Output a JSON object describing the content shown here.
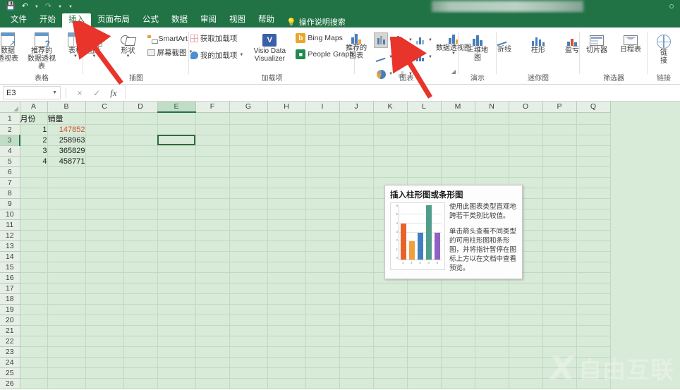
{
  "titlebar": {
    "quick_access": [
      "save-icon",
      "undo-icon",
      "redo-icon",
      "customize-icon"
    ],
    "title_redacted": ""
  },
  "tabs": [
    {
      "label": "文件",
      "active": false
    },
    {
      "label": "开始",
      "active": false
    },
    {
      "label": "插入",
      "active": true
    },
    {
      "label": "页面布局",
      "active": false
    },
    {
      "label": "数据",
      "active": false
    },
    {
      "label": "公式",
      "active": false
    },
    {
      "label": "审阅",
      "active": false
    },
    {
      "label": "视图",
      "active": false
    },
    {
      "label": "帮助",
      "active": false
    }
  ],
  "tabs_ordered": [
    "文件",
    "开始",
    "插入",
    "页面布局",
    "公式",
    "数据",
    "审阅",
    "视图",
    "帮助"
  ],
  "tell_me": "操作说明搜索",
  "ribbon": {
    "groups": [
      {
        "name": "表格",
        "buttons": [
          {
            "label1": "数据",
            "label2": "透视表"
          },
          {
            "label1": "推荐的",
            "label2": "数据透视表"
          },
          {
            "label1": "表格",
            "label2": ""
          }
        ]
      },
      {
        "name": "插图",
        "buttons": [
          {
            "label1": "图片",
            "label2": ""
          },
          {
            "label1": "形状",
            "label2": ""
          }
        ],
        "small": [
          "SmartArt",
          "屏幕截图"
        ]
      },
      {
        "name": "加载项",
        "small": [
          "获取加载项",
          "我的加载项"
        ],
        "buttons": [
          {
            "label1": "Visio Data",
            "label2": "Visualizer"
          }
        ],
        "apps": [
          "Bing Maps",
          "People Graph"
        ]
      },
      {
        "name": "图表",
        "buttons": [
          {
            "label1": "推荐的",
            "label2": "图表"
          },
          {
            "label1": "数据透视图",
            "label2": ""
          }
        ]
      },
      {
        "name": "演示",
        "buttons": [
          {
            "label1": "三维地",
            "label2": "图"
          }
        ]
      },
      {
        "name": "迷你图",
        "buttons": [
          {
            "label1": "折线",
            "label2": ""
          },
          {
            "label1": "柱形",
            "label2": ""
          },
          {
            "label1": "盈亏",
            "label2": ""
          }
        ]
      },
      {
        "name": "筛选器",
        "buttons": [
          {
            "label1": "切片器",
            "label2": ""
          },
          {
            "label1": "日程表",
            "label2": ""
          }
        ]
      },
      {
        "name": "链接",
        "buttons": [
          {
            "label1": "链",
            "label2": "接"
          }
        ]
      }
    ]
  },
  "formula_bar": {
    "name_box": "E3",
    "cancel_icon": "×",
    "confirm_icon": "✓",
    "fx_icon": "fx",
    "value": ""
  },
  "sheet": {
    "columns": [
      "A",
      "B",
      "C",
      "D",
      "E",
      "F",
      "G",
      "H",
      "I",
      "J",
      "K",
      "L",
      "M",
      "N",
      "O",
      "P",
      "Q"
    ],
    "selected_column": "E",
    "rows": [
      1,
      2,
      3,
      4,
      5,
      6,
      7,
      8,
      9,
      10,
      11,
      12,
      13,
      14,
      15,
      16,
      17,
      18,
      19,
      20,
      21,
      22,
      23,
      24,
      25,
      26
    ],
    "selected_row": 3,
    "active_cell": "E3",
    "data": [
      {
        "row": 1,
        "A": "月份",
        "B": "销量"
      },
      {
        "row": 2,
        "A": "1",
        "B": "147852"
      },
      {
        "row": 3,
        "A": "2",
        "B": "258963"
      },
      {
        "row": 4,
        "A": "3",
        "B": "365829"
      },
      {
        "row": 5,
        "A": "4",
        "B": "458771"
      }
    ]
  },
  "tooltip": {
    "title": "插入柱形图或条形图",
    "paragraph1": "使用此图表类型直观地跨若干类别比较值。",
    "paragraph2": "单击箭头查看不同类型的可用柱形图和条形图，并将指针暂停在图标上方以在文档中查看预览。"
  },
  "chart_data": {
    "type": "bar",
    "title": "",
    "categories": [
      "1",
      "2",
      "3",
      "4",
      "5"
    ],
    "values": [
      4,
      2,
      3,
      6,
      3
    ],
    "colors": [
      "#e8622a",
      "#f2a03c",
      "#3f7fc1",
      "#4f9e8c",
      "#9061c2"
    ],
    "ylim": [
      0,
      6
    ],
    "yticks": [
      "6",
      "5",
      "4",
      "3",
      "2",
      "1",
      "0"
    ],
    "xlabel": "",
    "ylabel": "",
    "grid": true,
    "legend": "none"
  },
  "watermark": {
    "logo": "X",
    "text": "自由互联"
  },
  "colors": {
    "excel_green": "#217346",
    "sheet_bg": "#d8ead8",
    "header_bg": "#e6efe6",
    "red_value": "#d0532f",
    "arrow_red": "#e8342a"
  }
}
